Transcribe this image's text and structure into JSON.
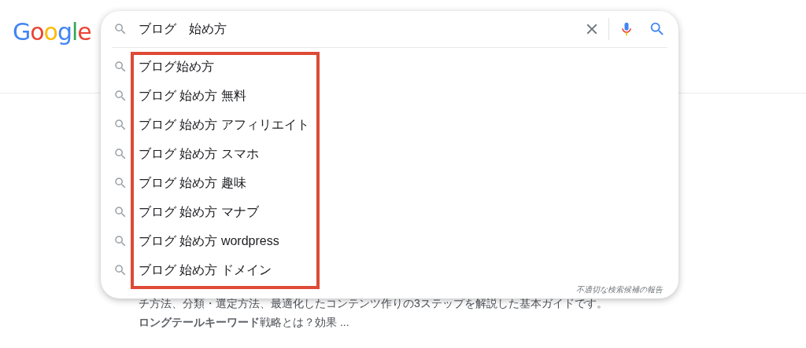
{
  "logo": {
    "text": "Google"
  },
  "search": {
    "value": "ブログ　始め方"
  },
  "suggestions": [
    {
      "text": "ブログ始め方"
    },
    {
      "text": "ブログ 始め方 無料"
    },
    {
      "text": "ブログ 始め方 アフィリエイト"
    },
    {
      "text": "ブログ 始め方 スマホ"
    },
    {
      "text": "ブログ 始め方 趣味"
    },
    {
      "text": "ブログ 始め方 マナブ"
    },
    {
      "text": "ブログ 始め方 wordpress"
    },
    {
      "text": "ブログ 始め方 ドメイン"
    }
  ],
  "report_link": "不適切な検索候補の報告",
  "result_snippet": [
    "チ方法、分類・選定方法、最適化したコンテンツ作りの3ステップを解説した基本ガイドです。",
    "**ロングテールキーワード**戦略とは？効果 ..."
  ]
}
